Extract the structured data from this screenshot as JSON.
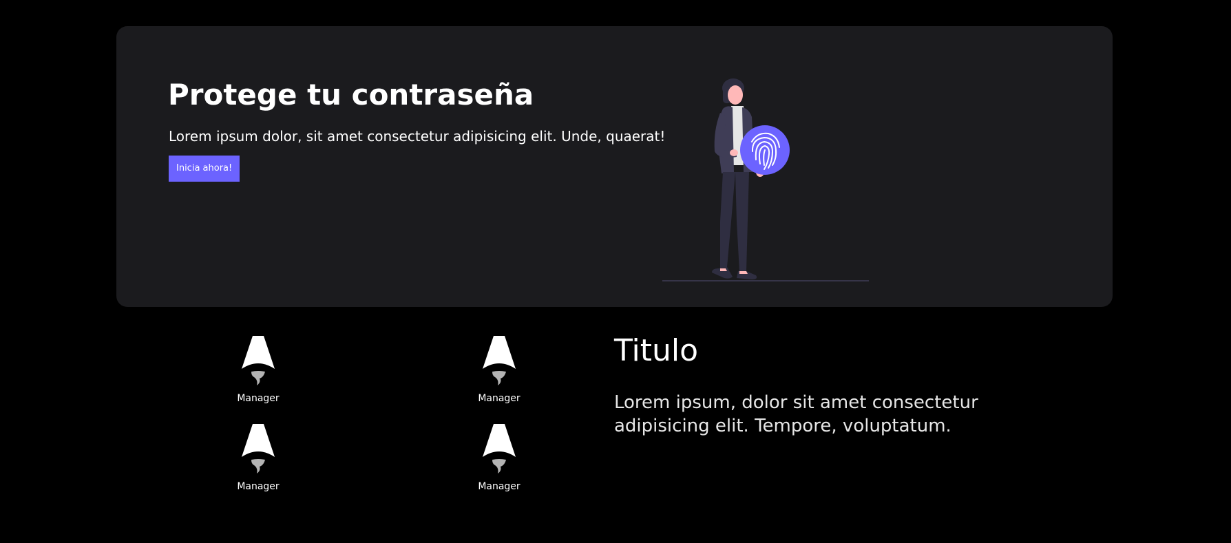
{
  "hero": {
    "title": "Protege tu contraseña",
    "subtitle": "Lorem ipsum dolor, sit amet consectetur adipisicing elit. Unde, quaerat!",
    "cta_label": "Inicia ahora!"
  },
  "features": [
    {
      "label": "Manager",
      "icon": "astro-logo-icon"
    },
    {
      "label": "Manager",
      "icon": "astro-logo-icon"
    },
    {
      "label": "Manager",
      "icon": "astro-logo-icon"
    },
    {
      "label": "Manager",
      "icon": "astro-logo-icon"
    }
  ],
  "info": {
    "title": "Titulo",
    "text": "Lorem ipsum, dolor sit amet consectetur adipisicing elit. Tempore, voluptatum."
  },
  "colors": {
    "page_background": "#000000",
    "card_background": "#1b1b1e",
    "accent": "#6c63ff",
    "text": "#ffffff"
  }
}
